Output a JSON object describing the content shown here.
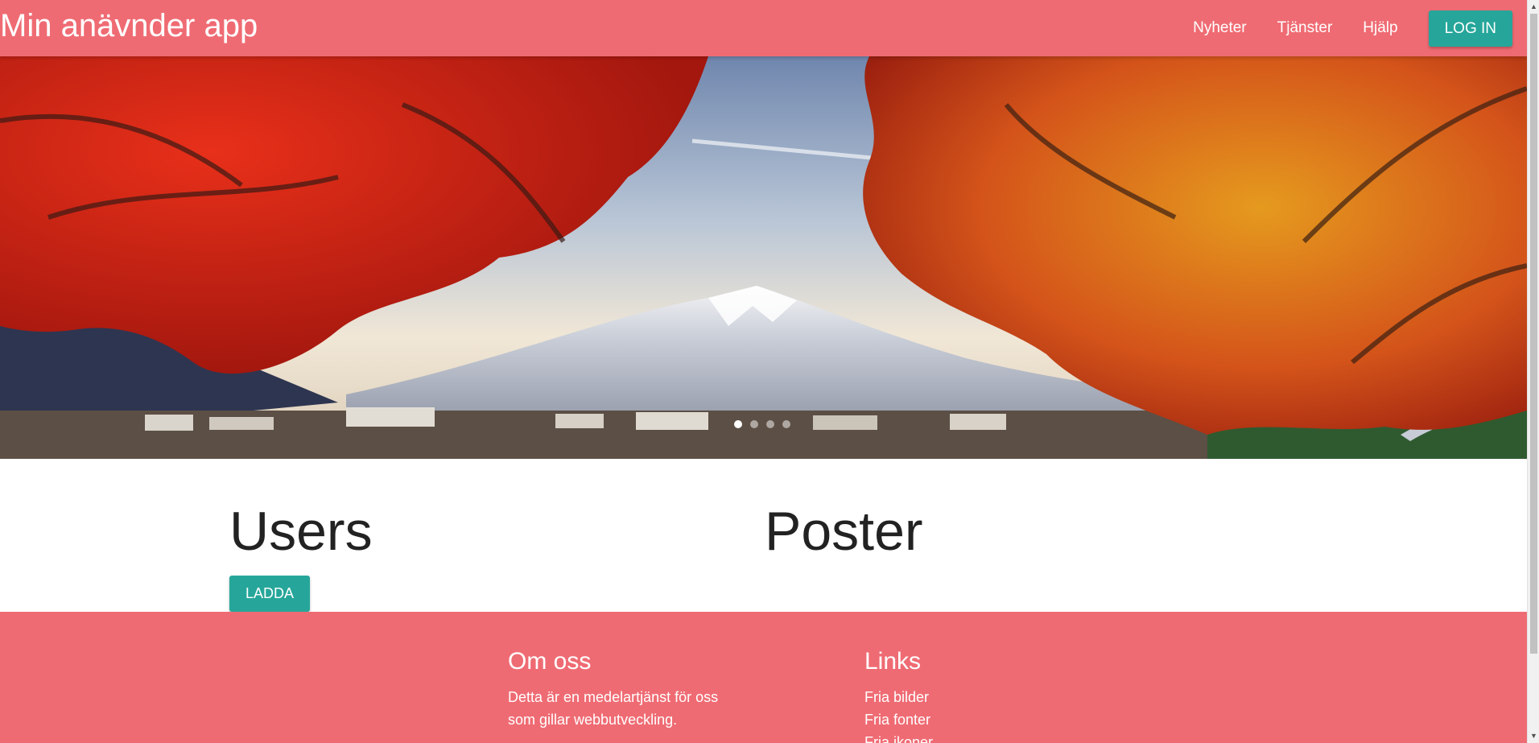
{
  "navbar": {
    "brand": "Min anävnder app",
    "links": [
      "Nyheter",
      "Tjänster",
      "Hjälp"
    ],
    "login_label": "LOG IN",
    "color": "#ef6b73"
  },
  "carousel": {
    "slide_count": 4,
    "active_index": 0
  },
  "main": {
    "users_title": "Users",
    "load_label": "LADDA",
    "poster_title": "Poster",
    "accent": "#26a69a"
  },
  "footer": {
    "about_title": "Om oss",
    "about_text": "Detta är en medelartjänst för oss som gillar webbutveckling.",
    "links_title": "Links",
    "links": [
      "Fria bilder",
      "Fria fonter",
      "Fria ikoner"
    ]
  }
}
